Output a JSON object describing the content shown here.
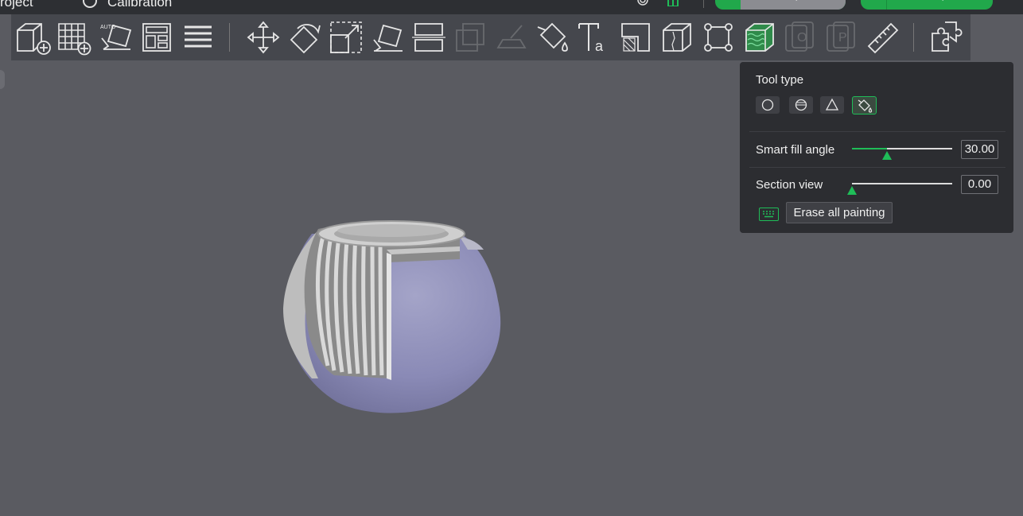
{
  "topbar": {
    "menu_project": "roject",
    "menu_calibration": "Calibration",
    "slice_label": "Slice plate",
    "print_label": "Print plate"
  },
  "toolbar": {
    "tools": [
      "add-object",
      "add-plate",
      "auto-orient",
      "arrange",
      "split-layers",
      "move",
      "rotate",
      "scale",
      "lay-on-face",
      "cut",
      "support-painting",
      "seam-painting",
      "color-painting",
      "text",
      "measure-area",
      "brim-ears",
      "assembly",
      "fuzzy-skin",
      "variable-layer",
      "object-list",
      "param-list",
      "measure",
      "assemble-view"
    ]
  },
  "panel": {
    "tool_type_label": "Tool type",
    "tool_buttons": [
      "circle",
      "sphere",
      "triangle",
      "fill"
    ],
    "active_tool": "fill",
    "smart_fill_label": "Smart fill angle",
    "smart_fill_value": "30.00",
    "smart_fill_fraction": 0.35,
    "section_view_label": "Section view",
    "section_view_value": "0.00",
    "section_view_fraction": 0.0,
    "erase_label": "Erase all painting"
  },
  "colors": {
    "accent": "#1fbd58",
    "background": "#5a5b61",
    "panel": "#2c2d31",
    "paint": "#8c8cba"
  }
}
